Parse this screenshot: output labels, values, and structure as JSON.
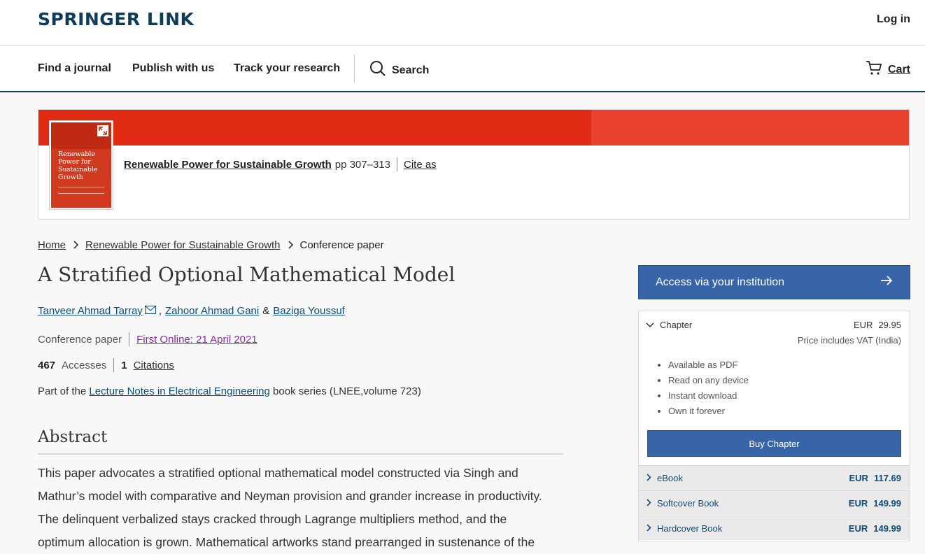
{
  "header": {
    "logo": "SPRINGER LINK",
    "login": "Log in"
  },
  "nav": {
    "items": [
      "Find a journal",
      "Publish with us",
      "Track your research"
    ],
    "search": "Search",
    "cart": "Cart"
  },
  "banner": {
    "cover_title": "Renewable Power for Sustainable Growth",
    "book_title": "Renewable Power for Sustainable Growth",
    "pages": "pp 307–313",
    "cite": "Cite as"
  },
  "breadcrumb": {
    "home": "Home",
    "book": "Renewable Power for Sustainable Growth",
    "current": "Conference paper"
  },
  "article": {
    "title": "A Stratified Optional Mathematical Model",
    "authors": [
      "Tanveer Ahmad Tarray",
      "Zahoor Ahmad Gani",
      "Baziga Youssuf"
    ],
    "author_sep_comma": ",",
    "author_sep_amp": "&",
    "type": "Conference paper",
    "first_online": "First Online: 21 April 2021",
    "accesses_num": "467",
    "accesses_label": "Accesses",
    "citations_num": "1",
    "citations_label": "Citations",
    "series_prefix": "Part of the",
    "series_link": "Lecture Notes in Electrical Engineering",
    "series_suffix": "book series (LNEE,volume 723)",
    "abstract_heading": "Abstract",
    "abstract_lines": [
      "This paper advocates a stratified optional mathematical model constructed via Singh and",
      "Mathur’s model with comparative and Neyman provision and grander increase in productivity.",
      "The delinquent verbalized stays cracked through Lagrange multipliers method, and the",
      "optimum allocation is grown. Mathematical artworks stand prearranged in sustenance of the"
    ]
  },
  "sidebar": {
    "access_button": "Access via your institution",
    "chapter_label": "Chapter",
    "currency": "EUR",
    "chapter_price": "29.95",
    "vat_note": "Price includes VAT (India)",
    "benefits": [
      "Available as PDF",
      "Read on any device",
      "Instant download",
      "Own it forever"
    ],
    "buy_button": "Buy Chapter",
    "formats": [
      {
        "name": "eBook",
        "currency": "EUR",
        "price": "117.69"
      },
      {
        "name": "Softcover Book",
        "currency": "EUR",
        "price": "149.99"
      },
      {
        "name": "Hardcover Book",
        "currency": "EUR",
        "price": "149.99"
      }
    ]
  },
  "colors": {
    "brand": "#0f3d57",
    "banner_red": "#e02a14",
    "button_blue": "#3865a8",
    "link_blue": "#0c4d7a",
    "visited_purple": "#8a2aa3"
  }
}
